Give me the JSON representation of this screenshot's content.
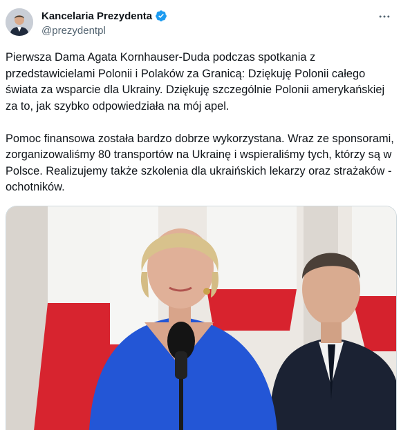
{
  "author": {
    "name": "Kancelaria Prezydenta",
    "handle": "@prezydentpl",
    "verified": true
  },
  "icons": {
    "avatar": "profile-photo",
    "verified": "verified-badge-icon",
    "more": "more-options-icon"
  },
  "tweet": {
    "paragraphs": [
      "Pierwsza Dama Agata Kornhauser-Duda podczas spotkania z przedstawicielami Polonii i Polaków za Granicą: Dziękuję Polonii całego świata za wsparcie dla Ukrainy. Dziękuję szczególnie Polonii amerykańskiej za to, jak szybko odpowiedziała na mój apel.",
      "Pomoc finansowa została bardzo dobrze wykorzystana. Wraz ze sponsorami, zorganizowaliśmy 80 transportów na Ukrainę i wspieraliśmy tych, którzy są w Polsce. Realizujemy także szkolenia dla ukraińskich lekarzy oraz strażaków - ochotników."
    ]
  },
  "colors": {
    "verified": "#1d9bf0",
    "text": "#0f1419",
    "secondary": "#536471",
    "border": "#cfd9de"
  }
}
